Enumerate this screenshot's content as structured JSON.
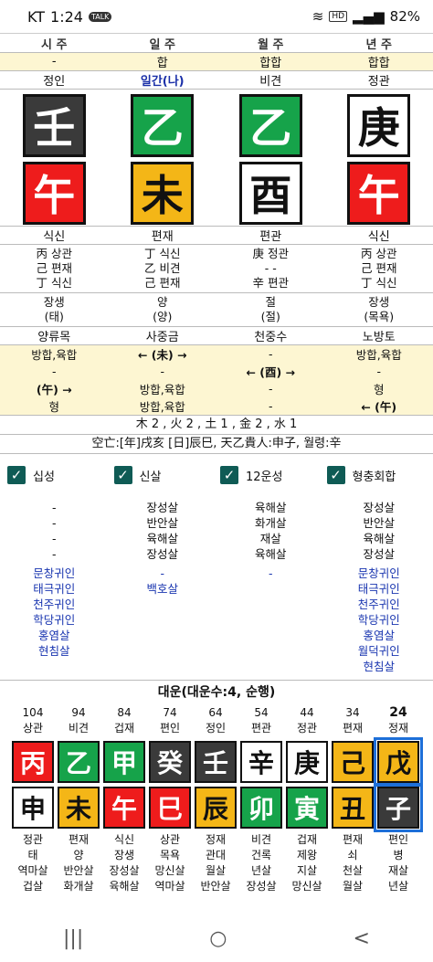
{
  "status_bar": {
    "carrier": "KT",
    "time": "1:24",
    "talk": "TALK",
    "hd": "HD",
    "battery": "82%"
  },
  "headers": [
    "시 주",
    "일 주",
    "월 주",
    "년 주"
  ],
  "top_relation": [
    "-",
    "합",
    "합합",
    "합합"
  ],
  "ten_gods_top": [
    "정인",
    "일간(나)",
    "비견",
    "정관"
  ],
  "stems": [
    {
      "char": "壬",
      "color": "black"
    },
    {
      "char": "乙",
      "color": "green"
    },
    {
      "char": "乙",
      "color": "green"
    },
    {
      "char": "庚",
      "color": "white"
    }
  ],
  "branches": [
    {
      "char": "午",
      "color": "red"
    },
    {
      "char": "未",
      "color": "yellow"
    },
    {
      "char": "酉",
      "color": "white"
    },
    {
      "char": "午",
      "color": "red"
    }
  ],
  "ten_gods_bottom": [
    "식신",
    "편재",
    "편관",
    "식신"
  ],
  "hidden_stems": [
    [
      "丙 상관",
      "己 편재",
      "丁 식신"
    ],
    [
      "丁 식신",
      "乙 비견",
      "己 편재"
    ],
    [
      "庚 정관",
      "- -",
      "辛 편관"
    ],
    [
      "丙 상관",
      "己 편재",
      "丁 식신"
    ]
  ],
  "twelve_stage": [
    [
      "장생",
      "(태)"
    ],
    [
      "양",
      "(양)"
    ],
    [
      "절",
      "(절)"
    ],
    [
      "장생",
      "(목욕)"
    ]
  ],
  "nayin": [
    "양류목",
    "사중금",
    "천중수",
    "노방토"
  ],
  "relations": [
    [
      "방합,육합",
      "← (未) →",
      "-",
      "방합,육합"
    ],
    [
      "-",
      "-",
      "← (酉) →",
      "-"
    ],
    [
      "(午) →",
      "방합,육합",
      "-",
      "형"
    ],
    [
      "형",
      "방합,육합",
      "-",
      "← (午)"
    ]
  ],
  "elements_summary": "木 2 , 火 2 , 土 1 , 金 2 , 水 1",
  "gongmang_summary": "空亡:[年]戌亥 [日]辰巳, 天乙貴人:申子, 월령:辛",
  "checkboxes": [
    "십성",
    "신살",
    "12운성",
    "형충회합"
  ],
  "sinsal": [
    [
      "-",
      "장성살",
      "육해살",
      "장성살"
    ],
    [
      "-",
      "반안살",
      "화개살",
      "반안살"
    ],
    [
      "-",
      "육해살",
      "재살",
      "육해살"
    ],
    [
      "-",
      "장성살",
      "육해살",
      "장성살"
    ]
  ],
  "guiin": [
    [
      "문창귀인",
      "태극귀인",
      "천주귀인",
      "학당귀인",
      "홍염살",
      "현침살"
    ],
    [
      "-",
      "백호살"
    ],
    [
      "-"
    ],
    [
      "문창귀인",
      "태극귀인",
      "천주귀인",
      "학당귀인",
      "홍염살",
      "월덕귀인",
      "현침살"
    ]
  ],
  "daeun_title": "대운(대운수:4, 순행)",
  "daeun": [
    {
      "age": "104",
      "top": "상관",
      "stem": "丙",
      "sc": "red",
      "branch": "申",
      "bc": "white",
      "bot": "정관",
      "stage": "태",
      "s1": "역마살",
      "s2": "겁살"
    },
    {
      "age": "94",
      "top": "비견",
      "stem": "乙",
      "sc": "green",
      "branch": "未",
      "bc": "yellow",
      "bot": "편재",
      "stage": "양",
      "s1": "반안살",
      "s2": "화개살"
    },
    {
      "age": "84",
      "top": "겁재",
      "stem": "甲",
      "sc": "green",
      "branch": "午",
      "bc": "red",
      "bot": "식신",
      "stage": "장생",
      "s1": "장성살",
      "s2": "육해살"
    },
    {
      "age": "74",
      "top": "편인",
      "stem": "癸",
      "sc": "black",
      "branch": "巳",
      "bc": "red",
      "bot": "상관",
      "stage": "목욕",
      "s1": "망신살",
      "s2": "역마살"
    },
    {
      "age": "64",
      "top": "정인",
      "stem": "壬",
      "sc": "black",
      "branch": "辰",
      "bc": "yellow",
      "bot": "정재",
      "stage": "관대",
      "s1": "월살",
      "s2": "반안살"
    },
    {
      "age": "54",
      "top": "편관",
      "stem": "辛",
      "sc": "white",
      "branch": "卯",
      "bc": "green",
      "bot": "비견",
      "stage": "건록",
      "s1": "년살",
      "s2": "장성살"
    },
    {
      "age": "44",
      "top": "정관",
      "stem": "庚",
      "sc": "white",
      "branch": "寅",
      "bc": "green",
      "bot": "겁재",
      "stage": "제왕",
      "s1": "지살",
      "s2": "망신살"
    },
    {
      "age": "34",
      "top": "편재",
      "stem": "己",
      "sc": "yellow",
      "branch": "丑",
      "bc": "yellow",
      "bot": "편재",
      "stage": "쇠",
      "s1": "천살",
      "s2": "월살"
    },
    {
      "age": "24",
      "top": "정재",
      "stem": "戊",
      "sc": "yellow",
      "branch": "子",
      "bc": "black",
      "bot": "편인",
      "stage": "병",
      "s1": "재살",
      "s2": "년살"
    }
  ],
  "nav": {
    "recent": "|||",
    "home": "○",
    "back": "<"
  }
}
